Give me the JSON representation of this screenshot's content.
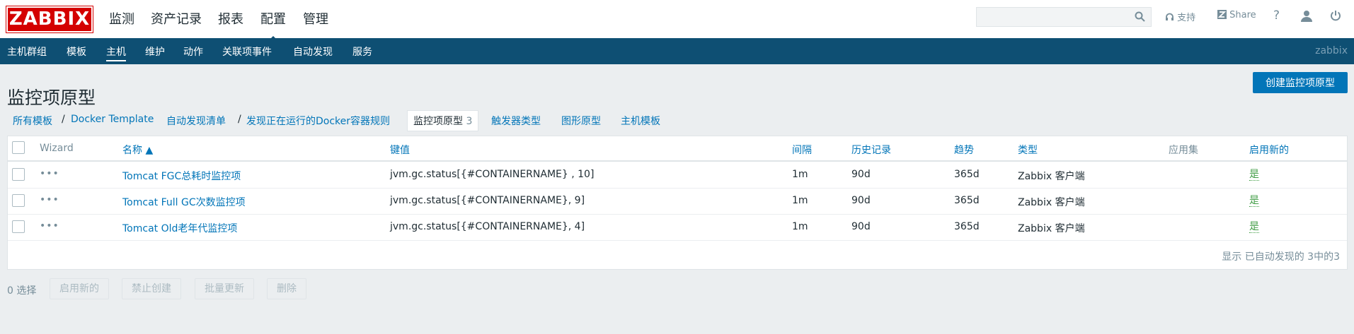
{
  "header": {
    "logo": "ZABBIX",
    "nav": [
      "监测",
      "资产记录",
      "报表",
      "配置",
      "管理"
    ],
    "active_nav": "配置",
    "search": {
      "value": "",
      "placeholder": ""
    },
    "support_label": "支持",
    "share_label": "Share",
    "help_label": "?"
  },
  "subnav": {
    "items": [
      "主机群组",
      "模板",
      "主机",
      "维护",
      "动作",
      "关联项事件",
      "自动发现",
      "服务"
    ],
    "active": "主机",
    "server_name": "zabbix"
  },
  "page": {
    "title": "监控项原型",
    "create_button": "创建监控项原型"
  },
  "breadcrumbs": {
    "all_templates": "所有模板",
    "separator": "/",
    "template": "Docker Template",
    "discovery_list": "自动发现清单",
    "discovery_rule": "发现正在运行的Docker容器规则",
    "item_prototypes": "监控项原型",
    "item_prototypes_count": "3",
    "trigger_prototypes": "触发器类型",
    "graph_prototypes": "图形原型",
    "host_prototypes": "主机模板"
  },
  "table": {
    "columns": {
      "wizard": "Wizard",
      "name": "名称 ▲",
      "key": "键值",
      "interval": "间隔",
      "history": "历史记录",
      "trends": "趋势",
      "type": "类型",
      "applications": "应用集",
      "create_enabled": "启用新的"
    },
    "rows": [
      {
        "dots": "•••",
        "name": "Tomcat FGC总耗时监控项",
        "key": "jvm.gc.status[{#CONTAINERNAME} , 10]",
        "interval": "1m",
        "history": "90d",
        "trends": "365d",
        "type": "Zabbix 客户端",
        "applications": "",
        "create_enabled": "是"
      },
      {
        "dots": "•••",
        "name": "Tomcat Full GC次数监控项",
        "key": "jvm.gc.status[{#CONTAINERNAME}, 9]",
        "interval": "1m",
        "history": "90d",
        "trends": "365d",
        "type": "Zabbix 客户端",
        "applications": "",
        "create_enabled": "是"
      },
      {
        "dots": "•••",
        "name": "Tomcat Old老年代监控项",
        "key": "jvm.gc.status[{#CONTAINERNAME}, 4]",
        "interval": "1m",
        "history": "90d",
        "trends": "365d",
        "type": "Zabbix 客户端",
        "applications": "",
        "create_enabled": "是"
      }
    ],
    "footer": "显示 已自动发现的 3中的3"
  },
  "actions": {
    "selected_count": "0 选择",
    "enable_create": "启用新的",
    "disable_create": "禁止创建",
    "mass_update": "批量更新",
    "delete": "删除"
  },
  "colors": {
    "header_blue": "#0e4f73",
    "link_blue": "#0275b8",
    "logo_red": "#d40000",
    "enabled_green": "#429e47"
  }
}
